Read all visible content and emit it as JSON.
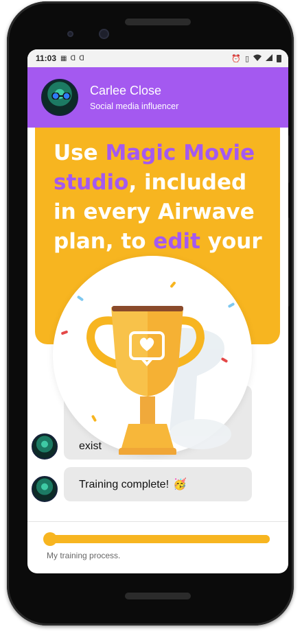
{
  "status_bar": {
    "time": "11:03",
    "left_icons": [
      "sim-icon",
      "cast-icon",
      "cast-icon"
    ],
    "right_icons": [
      "alarm-icon",
      "vibrate-icon",
      "wifi-icon",
      "signal-icon",
      "battery-icon"
    ]
  },
  "profile": {
    "name": "Carlee Close",
    "role": "Social media influencer"
  },
  "promo": {
    "prefix": "Use ",
    "highlight_1": "Magic Movie studio",
    "middle": ", included in every Airwave plan, to ",
    "highlight_2": "edit",
    "suffix": " your"
  },
  "messages": [
    {
      "text": "exist"
    },
    {
      "text": "Training complete!",
      "emoji": "🥳"
    }
  ],
  "progress": {
    "label": "My training process.",
    "fraction": 1.0
  },
  "colors": {
    "accent_purple": "#a459f0",
    "accent_yellow": "#f7b520"
  },
  "overlay": {
    "icon": "trophy-icon"
  }
}
